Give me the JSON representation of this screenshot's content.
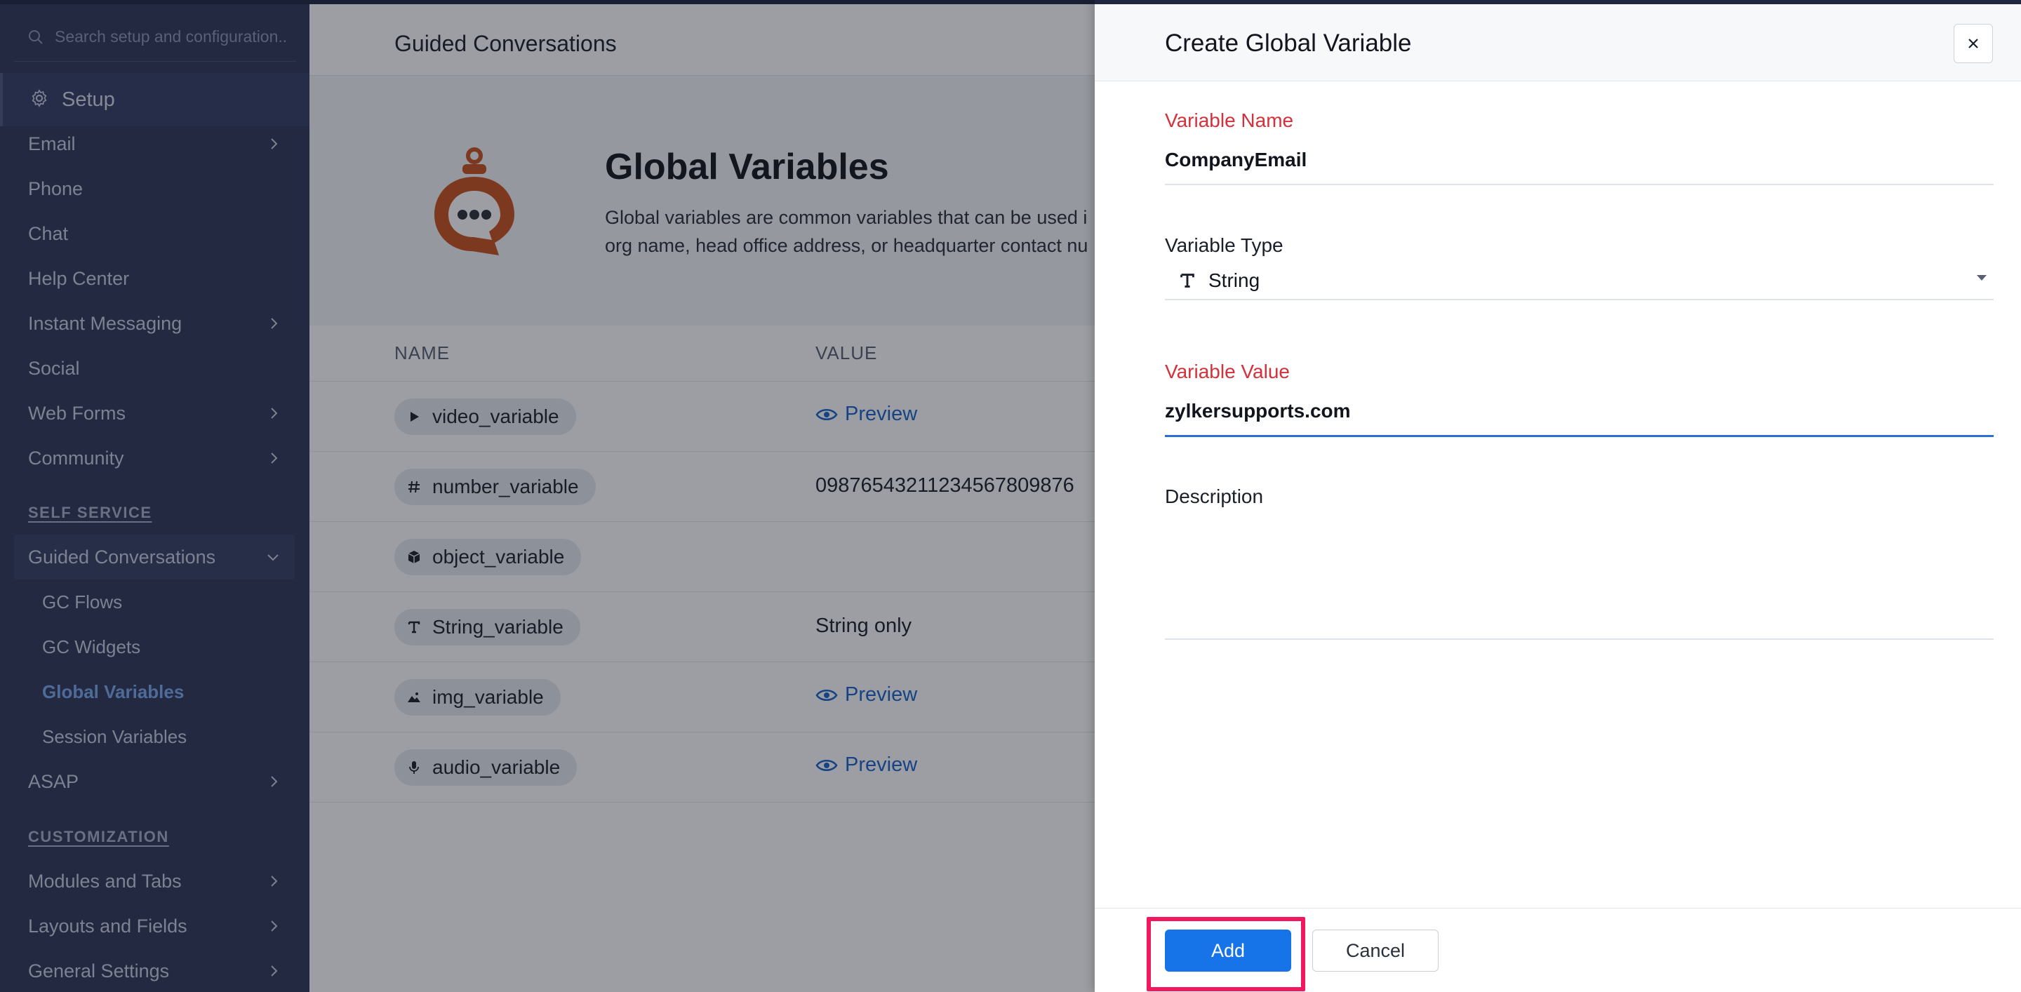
{
  "sidebar": {
    "search_placeholder": "Search setup and configuration..",
    "setup_label": "Setup",
    "items": [
      {
        "label": "Email",
        "has_chevron": true
      },
      {
        "label": "Phone",
        "has_chevron": false
      },
      {
        "label": "Chat",
        "has_chevron": false
      },
      {
        "label": "Help Center",
        "has_chevron": false
      },
      {
        "label": "Instant Messaging",
        "has_chevron": true
      },
      {
        "label": "Social",
        "has_chevron": false
      },
      {
        "label": "Web Forms",
        "has_chevron": true
      },
      {
        "label": "Community",
        "has_chevron": true
      }
    ],
    "self_service_heading": "SELF SERVICE",
    "guided_conversations": "Guided Conversations",
    "gc_sub": [
      "GC Flows",
      "GC Widgets",
      "Global Variables",
      "Session Variables"
    ],
    "asap": "ASAP",
    "customization_heading": "CUSTOMIZATION",
    "customization_items": [
      "Modules and Tabs",
      "Layouts and Fields",
      "General Settings"
    ]
  },
  "main": {
    "header_title": "Guided Conversations",
    "hero_title": "Global Variables",
    "hero_desc_line1": "Global variables are common variables that can be used i",
    "hero_desc_line2": "org name, head office address, or headquarter contact nu",
    "col_name": "NAME",
    "col_value": "VALUE",
    "rows": [
      {
        "name": "video_variable",
        "icon": "play-icon",
        "value": "Preview",
        "is_link": true
      },
      {
        "name": "number_variable",
        "icon": "hash-icon",
        "value": "09876543211234567809876",
        "is_link": false
      },
      {
        "name": "object_variable",
        "icon": "cube-icon",
        "value": "",
        "is_link": false
      },
      {
        "name": "String_variable",
        "icon": "text-icon",
        "value": "String only",
        "is_link": false
      },
      {
        "name": "img_variable",
        "icon": "image-icon",
        "value": "Preview",
        "is_link": true
      },
      {
        "name": "audio_variable",
        "icon": "mic-icon",
        "value": "Preview",
        "is_link": true
      }
    ]
  },
  "panel": {
    "title": "Create Global Variable",
    "variable_name_label": "Variable Name",
    "variable_name_value": "CompanyEmail",
    "variable_type_label": "Variable Type",
    "variable_type_value": "String",
    "variable_value_label": "Variable Value",
    "variable_value_value": "zylkersupports.com",
    "description_label": "Description",
    "add_label": "Add",
    "cancel_label": "Cancel"
  },
  "colors": {
    "sidebar_bg": "#2d3656",
    "accent_blue": "#1774e8",
    "required_red": "#d6303a",
    "highlight_pink": "#f0195e",
    "robot_orange": "#c9521c"
  }
}
